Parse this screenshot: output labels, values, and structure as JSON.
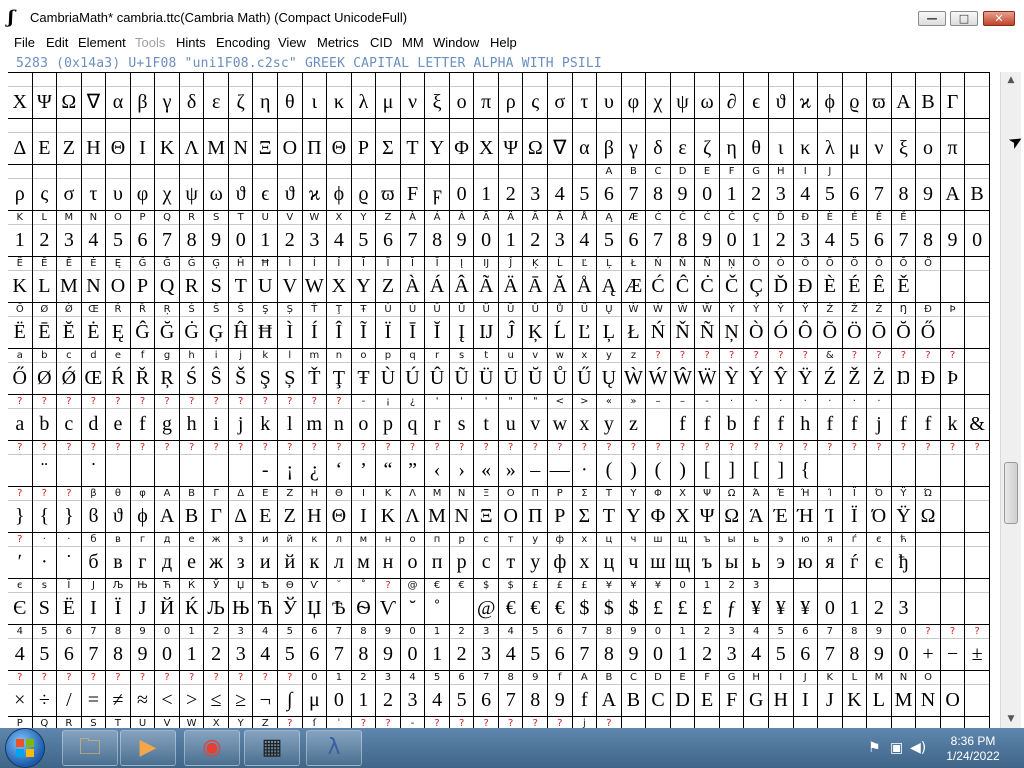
{
  "window": {
    "icon_glyph": "ʃ",
    "title": "CambriaMath*  cambria.ttc(Cambria Math) (Compact UnicodeFull)",
    "buttons": {
      "minimize": "—",
      "maximize": "□",
      "close": "✕"
    }
  },
  "menu": [
    {
      "label": "File",
      "enabled": true
    },
    {
      "label": "Edit",
      "enabled": true
    },
    {
      "label": "Element",
      "enabled": true
    },
    {
      "label": "Tools",
      "enabled": false
    },
    {
      "label": "Hints",
      "enabled": true
    },
    {
      "label": "Encoding",
      "enabled": true
    },
    {
      "label": "View",
      "enabled": true
    },
    {
      "label": "Metrics",
      "enabled": true
    },
    {
      "label": "CID",
      "enabled": true
    },
    {
      "label": "MM",
      "enabled": true
    },
    {
      "label": "Window",
      "enabled": true
    },
    {
      "label": "Help",
      "enabled": true
    }
  ],
  "info_line": "5283 (0x14a3) U+1F08 \"uni1F08.c2sc\" GREEK CAPITAL LETTER ALPHA WITH PSILI",
  "grid": {
    "columns": 40,
    "rows": [
      {
        "labels": "                                        ",
        "glyphs": "ΧΨΩ∇αβγδεζηθικλμνξοπρςστυφχψω∂ϵϑϰϕϱϖABΓ"
      },
      {
        "labels": "                                        ",
        "glyphs": "ΔΕΖΗΘΙΚΛΜΝΞΟΠΘΡΣΤΥΦΧΨΩ∇αβγδεζηθικλμνξοπ"
      },
      {
        "labels": "                        ABCDEFGHIJ",
        "glyphs": "ρςστυφχψωϑϵϑϰϕϱϖFϝ01234567890123456789ABCDEFGHIJ"
      },
      {
        "labels": "KLMNOPQRSTUVWXYZÀÁÂÃÄĀĂÅĄÆĆĈĊČÇĎĐÈÉÊĚ",
        "glyphs": "1234567890123456789012345678901234567890"
      },
      {
        "labels": "ËĒĔĖĘĜĞĠĢĤĦÌÍÎĨÏĪĬĮĲĴĶĹĽĻŁŃŇÑŅÒÓÔÕÖŌŎŐ",
        "glyphs": "KLMNOPQRSTUVWXYZÀÁÂÃÄĀĂÅĄÆĆĈĊČÇĎĐÈÉÊĚ"
      },
      {
        "labels": "ŐØǾŒŔŘŖŚŜŠŞȘŤŢŦÙÚÛŨÜŪŬŮŰŲẀẂŴẄỲÝŶŸŹŽŻŊÐÞ",
        "glyphs": "ËĒĔĖĘĜĞĠĢĤĦÌÍÎĨÏĪĬĮĲĴĶĹĽĻŁŃŇÑŅÒÓÔÕÖŌŎŐ"
      },
      {
        "labels": "abcdefghijklmnopqrstuvwxyz???????&?????",
        "glyphs": "ŐØǾŒŔŘŖŚŜŠŞȘŤŢŦÙÚÛŨÜŪŬŮŰŲẀẂŴẄỲÝŶŸŹŽŻŊÐÞ"
      },
      {
        "labels": "??????????????-¡¿'''\"\"<>«»––-·······",
        "glyphs": "abcdefghijklmnopqrstuvwxyz ffbffhffjffk&"
      },
      {
        "labels": "????????????????????????????????????????",
        "glyphs": " ¨ ˙      -¡¿‘’“”‹›«»–—·()()[][]{"
      },
      {
        "labels": "???βθφΑΒΓΔΕΖΗΘΙΚΛΜΝΞΟΠΡΣΤΥΦΧΨΩΆΈΉΊΪΌΫΏ",
        "glyphs": "}{}ϐϑϕΑΒΓΔΕΖΗΘΙΚΛΜΝΞΟΠΡΣΤΥΦΧΨΩΆΈΉΊΪΌΫΩ"
      },
      {
        "labels": "?··бвгдежзийклмнопрстуфхцчшщъыьэюяѓєћ",
        "glyphs": "ʹ·˙бвгдежзийклмнопрстуфхцчшщъыьэюяѓєђ"
      },
      {
        "labels": "єѕЇЈЉЊЋЌЎЏѢѲѴ˘˚?@€€$$£££¥¥¥0123",
        "glyphs": "ЄЅЁІЇЈЙЌЉЊЋЎЏѢѲѴ˘˚ @€€€$$$£££ƒ¥¥¥0123"
      },
      {
        "labels": "4567890123456789012345678901234567890???",
        "glyphs": "4567890123456789012345678901234567890+−±"
      },
      {
        "labels": "????????????0123456789fABCDEFGHIJKLMNO",
        "glyphs": "×÷/=≠≈<>≤≥¬∫μ0123456789fABCDEFGHIJKLMNO"
      },
      {
        "labels": "PQRSTUVWXYZ?ſˈ??-??????j?",
        "glyphs": "PQRSTUVWXYZ'ijˌ˘ϒθ ʲʲ ıȷ ıłıſı"
      }
    ]
  },
  "taskbar": {
    "apps": [
      {
        "name": "explorer",
        "glyph": "🗀"
      },
      {
        "name": "media-player",
        "glyph": "▶"
      },
      {
        "name": "chrome",
        "glyph": "◉"
      },
      {
        "name": "fontforge",
        "glyph": "▦"
      },
      {
        "name": "lambda-app",
        "glyph": "λ"
      }
    ],
    "clock_time": "8:36 PM",
    "clock_date": "1/24/2022"
  },
  "colors": {
    "info_text": "#6a8fc0",
    "missing_label": "#d32020",
    "taskbar": "#4a7199"
  }
}
